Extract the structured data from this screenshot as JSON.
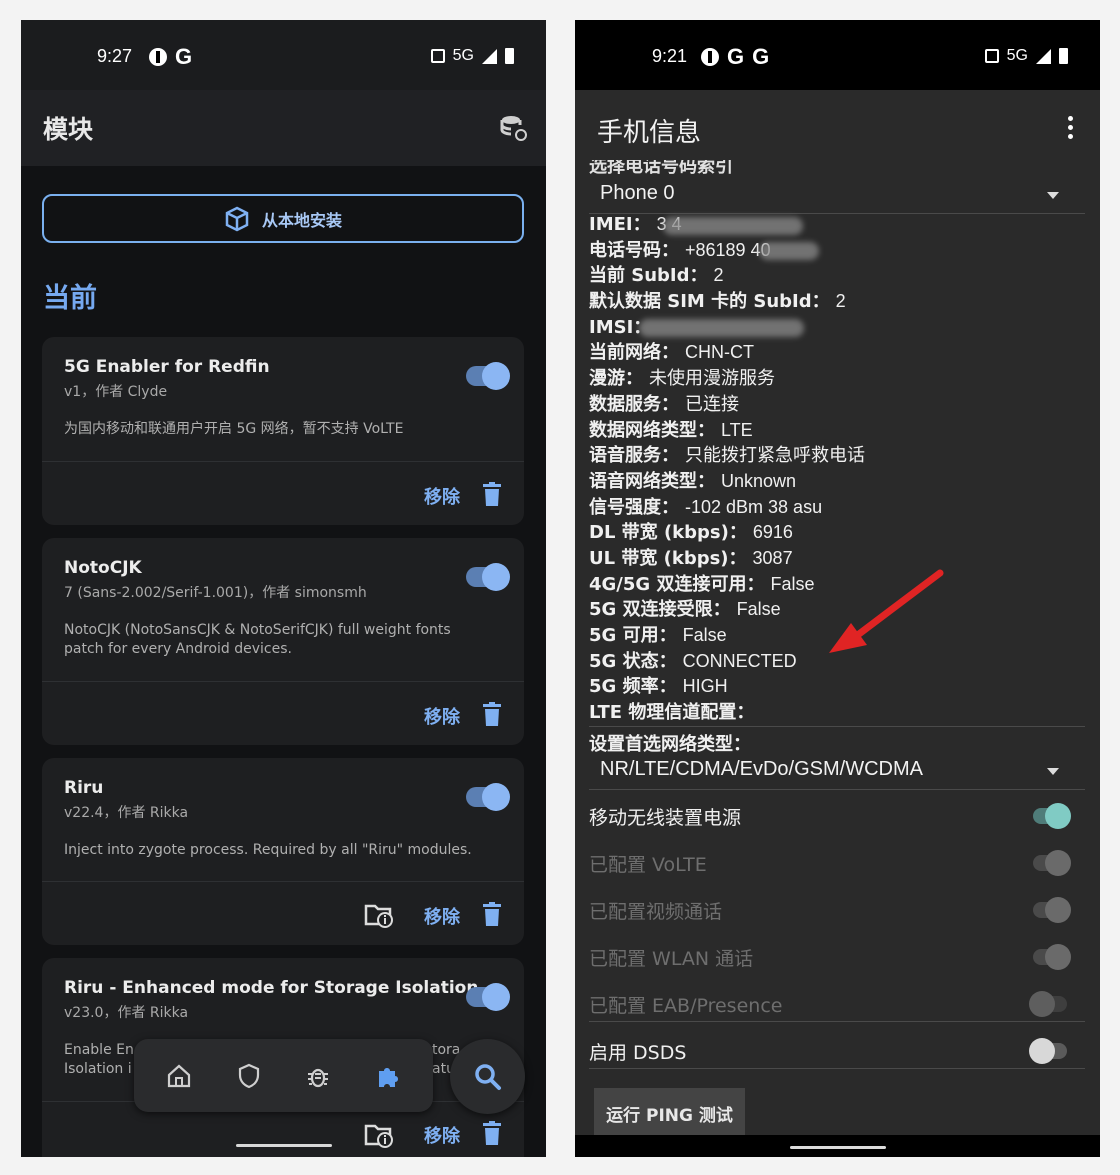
{
  "left": {
    "status": {
      "time": "9:27",
      "network": "5G"
    },
    "title": "模块",
    "install_label": "从本地安装",
    "section": "当前",
    "cards": [
      {
        "name": "5G Enabler for Redfin",
        "meta": "v1，作者 Clyde",
        "desc": "为国内移动和联通用户开启 5G 网络，暂不支持 VoLTE",
        "remove": "移除"
      },
      {
        "name": "NotoCJK",
        "meta": "7 (Sans-2.002/Serif-1.001)，作者 simonsmh",
        "desc": "NotoCJK (NotoSansCJK & NotoSerifCJK) full weight fonts patch for every Android devices.",
        "remove": "移除"
      },
      {
        "name": "Riru",
        "meta": "v22.4，作者 Rikka",
        "desc": "Inject into zygote process. Required by all \"Riru\" modules.",
        "remove": "移除"
      },
      {
        "name": "Riru - Enhanced mode for Storage Isolation",
        "meta": "v23.0，作者 Rikka",
        "desc_line1": "Enable En",
        "desc_line2": "Isolation i",
        "desc_tail1": "tora",
        "desc_tail2": "atu",
        "remove": "移除"
      }
    ],
    "nav": [
      "home-icon",
      "shield-icon",
      "bug-icon",
      "puzzle-icon"
    ],
    "fab": "search-icon"
  },
  "right": {
    "status": {
      "time": "9:21",
      "network": "5G"
    },
    "title": "手机信息",
    "cut_label": "选择电话号码索引",
    "phone_select": "Phone 0",
    "info": [
      {
        "k": "IMEI：",
        "v": "3                    4"
      },
      {
        "k": "电话号码：",
        "v": "+86189              40"
      },
      {
        "k": "当前 SubId：",
        "v": "2"
      },
      {
        "k": "默认数据 SIM 卡的 SubId：",
        "v": "2"
      },
      {
        "k": "IMSI：",
        "v": ""
      },
      {
        "k": "当前网络：",
        "v": "CHN-CT"
      },
      {
        "k": "漫游：",
        "v": "未使用漫游服务"
      },
      {
        "k": "数据服务：",
        "v": "已连接"
      },
      {
        "k": "数据网络类型：",
        "v": "LTE"
      },
      {
        "k": "语音服务：",
        "v": "只能拨打紧急呼救电话"
      },
      {
        "k": "语音网络类型：",
        "v": "Unknown"
      },
      {
        "k": "信号强度：",
        "v": "-102 dBm   38 asu"
      },
      {
        "k": "DL 带宽 (kbps)：",
        "v": "6916"
      },
      {
        "k": "UL 带宽 (kbps)：",
        "v": "3087"
      },
      {
        "k": "4G/5G 双连接可用：",
        "v": "False"
      },
      {
        "k": "5G 双连接受限：",
        "v": "False"
      },
      {
        "k": "5G 可用：",
        "v": "False"
      },
      {
        "k": "5G 状态：",
        "v": "CONNECTED"
      },
      {
        "k": "5G 频率：",
        "v": "HIGH"
      },
      {
        "k": "LTE 物理信道配置：",
        "v": ""
      }
    ],
    "pref_label": "设置首选网络类型：",
    "pref_value": "NR/LTE/CDMA/EvDo/GSM/WCDMA",
    "switches": [
      {
        "label": "移动无线装置电源",
        "on": true,
        "enabled": true
      },
      {
        "label": "已配置 VoLTE",
        "on": true,
        "enabled": false
      },
      {
        "label": "已配置视频通话",
        "on": true,
        "enabled": false
      },
      {
        "label": "已配置 WLAN 通话",
        "on": true,
        "enabled": false
      },
      {
        "label": "已配置 EAB/Presence",
        "on": false,
        "enabled": false
      },
      {
        "label": "启用 DSDS",
        "on": false,
        "enabled": true
      }
    ],
    "ping_label": "运行 PING 测试"
  },
  "colors": {
    "accent_blue": "#7fb0f2",
    "toggle_teal": "#80cbc4",
    "arrow_red": "#e02424"
  }
}
